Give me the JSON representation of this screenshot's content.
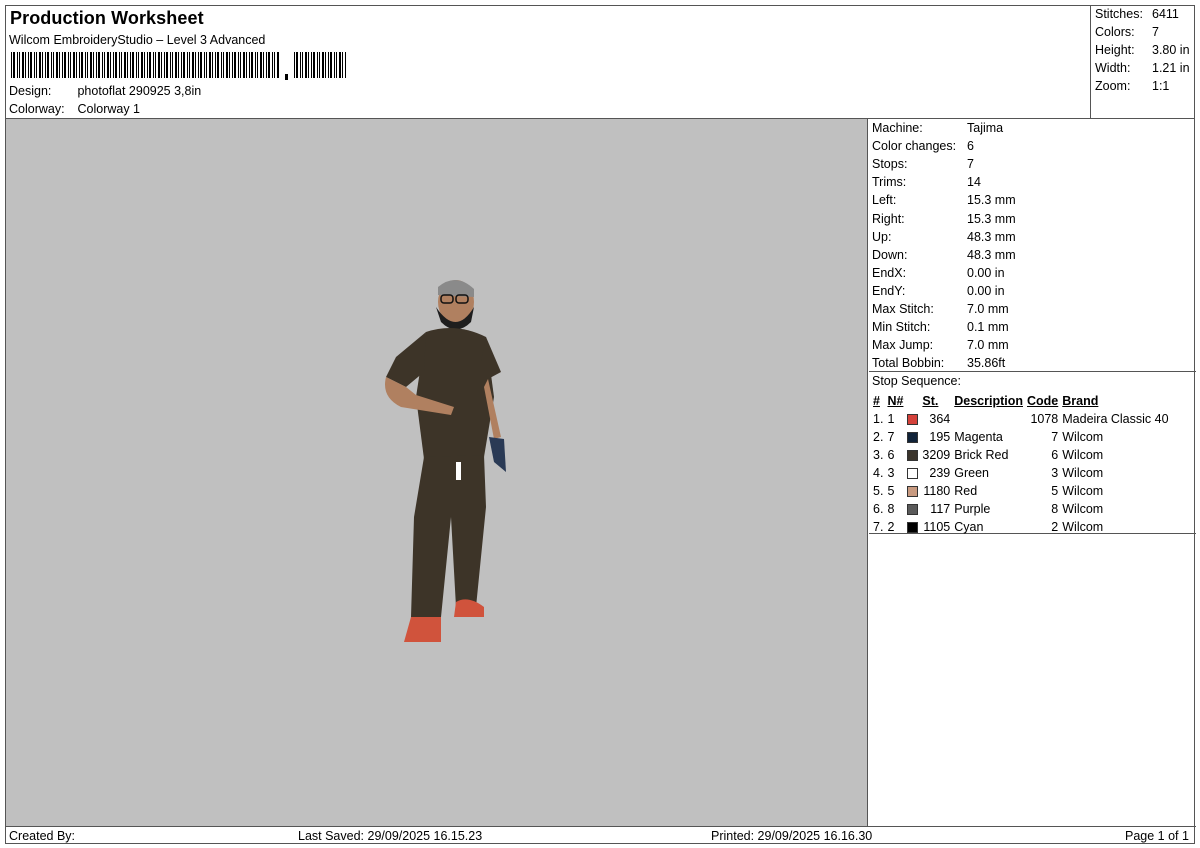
{
  "header": {
    "title": "Production Worksheet",
    "subtitle": "Wilcom EmbroideryStudio – Level 3 Advanced",
    "design_label": "Design:",
    "design_value": "photoflat 290925 3,8in",
    "colorway_label": "Colorway:",
    "colorway_value": "Colorway 1"
  },
  "summary": {
    "stitches_label": "Stitches:",
    "stitches": "6411",
    "colors_label": "Colors:",
    "colors": "7",
    "height_label": "Height:",
    "height": "3.80 in",
    "width_label": "Width:",
    "width": "1.21 in",
    "zoom_label": "Zoom:",
    "zoom": "1:1"
  },
  "machine": [
    {
      "label": "Machine:",
      "value": "Tajima"
    },
    {
      "label": "Color changes:",
      "value": "6"
    },
    {
      "label": "Stops:",
      "value": "7"
    },
    {
      "label": "Trims:",
      "value": "14"
    },
    {
      "label": "Left:",
      "value": "15.3 mm"
    },
    {
      "label": "Right:",
      "value": "15.3 mm"
    },
    {
      "label": "Up:",
      "value": "48.3 mm"
    },
    {
      "label": "Down:",
      "value": "48.3 mm"
    },
    {
      "label": "EndX:",
      "value": "0.00 in"
    },
    {
      "label": "EndY:",
      "value": "0.00 in"
    },
    {
      "label": "Max Stitch:",
      "value": "7.0 mm"
    },
    {
      "label": "Min Stitch:",
      "value": "0.1 mm"
    },
    {
      "label": "Max Jump:",
      "value": "7.0 mm"
    },
    {
      "label": "Total Bobbin:",
      "value": "35.86ft"
    }
  ],
  "stops": {
    "heading": "Stop Sequence:",
    "columns": [
      "#",
      "N#",
      "St.",
      "Description",
      "Code",
      "Brand"
    ],
    "rows": [
      {
        "idx": "1.",
        "n": "1",
        "color": "#d4413a",
        "st": "364",
        "desc": "",
        "code": "1078",
        "brand": "Madeira Classic 40"
      },
      {
        "idx": "2.",
        "n": "7",
        "color": "#102238",
        "st": "195",
        "desc": "Magenta",
        "code": "7",
        "brand": "Wilcom"
      },
      {
        "idx": "3.",
        "n": "6",
        "color": "#3a342b",
        "st": "3209",
        "desc": "Brick Red",
        "code": "6",
        "brand": "Wilcom"
      },
      {
        "idx": "4.",
        "n": "3",
        "color": "#ffffff",
        "st": "239",
        "desc": "Green",
        "code": "3",
        "brand": "Wilcom"
      },
      {
        "idx": "5.",
        "n": "5",
        "color": "#c89a80",
        "st": "1180",
        "desc": "Red",
        "code": "5",
        "brand": "Wilcom"
      },
      {
        "idx": "6.",
        "n": "8",
        "color": "#5a5a5a",
        "st": "117",
        "desc": "Purple",
        "code": "8",
        "brand": "Wilcom"
      },
      {
        "idx": "7.",
        "n": "2",
        "color": "#000000",
        "st": "1105",
        "desc": "Cyan",
        "code": "2",
        "brand": "Wilcom"
      }
    ]
  },
  "footer": {
    "created_by": "Created By:",
    "last_saved": "Last Saved: 29/09/2025 16.15.23",
    "printed": "Printed: 29/09/2025 16.16.30",
    "page": "Page 1 of 1"
  },
  "colors": {
    "preview_bg": "#c0c0c0",
    "shirt": "#3d3428",
    "skin": "#b08060",
    "shoe": "#d0533c"
  }
}
